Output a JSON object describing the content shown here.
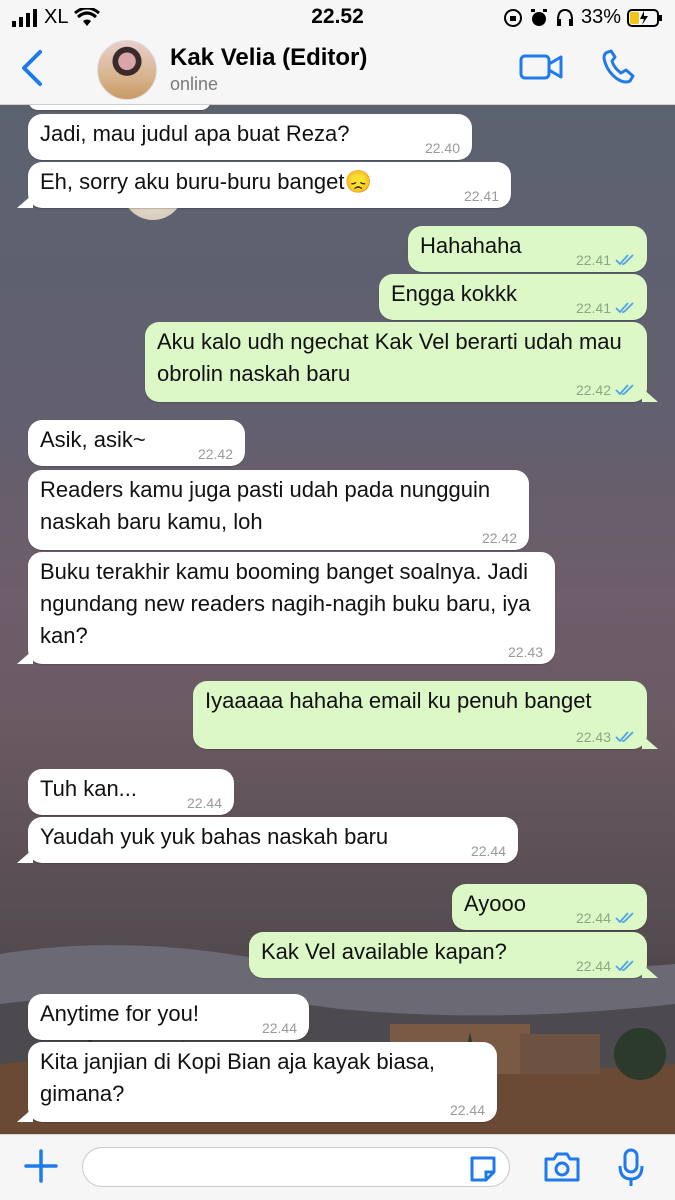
{
  "status_bar": {
    "carrier": "XL",
    "time": "22.52",
    "battery": "33%"
  },
  "header": {
    "contact_name": "Kak Velia (Editor)",
    "contact_status": "online",
    "icons": [
      "back-chevron-icon",
      "avatar",
      "video-call-icon",
      "phone-call-icon"
    ]
  },
  "messages": [
    {
      "dir": "in",
      "text": "Jadi, mau judul apa buat Reza?",
      "time": "22.40"
    },
    {
      "dir": "in",
      "text": "Eh, sorry aku buru-buru banget😞",
      "time": "22.41"
    },
    {
      "dir": "out",
      "text": "Hahahaha",
      "time": "22.41",
      "read": true
    },
    {
      "dir": "out",
      "text": "Engga kokkk",
      "time": "22.41",
      "read": true
    },
    {
      "dir": "out",
      "text": "Aku kalo udh ngechat Kak Vel berarti udah mau obrolin naskah baru",
      "time": "22.42",
      "read": true
    },
    {
      "dir": "in",
      "text": "Asik, asik~",
      "time": "22.42"
    },
    {
      "dir": "in",
      "text": "Readers kamu juga pasti udah pada nungguin naskah baru kamu, loh",
      "time": "22.42"
    },
    {
      "dir": "in",
      "text": "Buku terakhir kamu booming banget soalnya. Jadi ngundang new readers nagih-nagih buku baru, iya kan?",
      "time": "22.43"
    },
    {
      "dir": "out",
      "text": "Iyaaaaa hahaha email ku penuh banget",
      "time": "22.43",
      "read": true
    },
    {
      "dir": "in",
      "text": "Tuh kan...",
      "time": "22.44"
    },
    {
      "dir": "in",
      "text": "Yaudah yuk yuk bahas naskah baru",
      "time": "22.44"
    },
    {
      "dir": "out",
      "text": "Ayooo",
      "time": "22.44",
      "read": true
    },
    {
      "dir": "out",
      "text": "Kak Vel available kapan?",
      "time": "22.44",
      "read": true
    },
    {
      "dir": "in",
      "text": "Anytime for you!",
      "time": "22.44"
    },
    {
      "dir": "in",
      "text": "Kita janjian di Kopi Bian aja kayak biasa, gimana?",
      "time": "22.44"
    }
  ],
  "input_bar": {
    "message_value": "",
    "icons": [
      "plus-icon",
      "sticker-icon",
      "camera-icon",
      "microphone-icon"
    ]
  },
  "colors": {
    "accent": "#1f7aec",
    "outgoing_bubble": "#dcf8c6",
    "incoming_bubble": "#ffffff",
    "read_tick": "#4fa3e6"
  }
}
